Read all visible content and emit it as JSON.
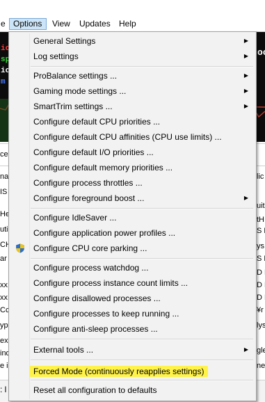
{
  "menubar": {
    "items": [
      {
        "label": "e"
      },
      {
        "label": "Options"
      },
      {
        "label": "View"
      },
      {
        "label": "Updates"
      },
      {
        "label": "Help"
      }
    ]
  },
  "background": {
    "graph_fragments": [
      "ic",
      "sp",
      "ic",
      "m"
    ],
    "graph_right_fragment": "oc",
    "mid_fragment": "ce",
    "list_left": [
      "na",
      "IS",
      "He",
      "uti",
      "CH",
      "ar",
      "xx",
      "xx",
      "Cc",
      "yp",
      "exe",
      "ind",
      "e i"
    ],
    "list_right": [
      "lic",
      "uit",
      "tH",
      "S R",
      "ys",
      "S M",
      "D E",
      "D E",
      "D E",
      "¥r",
      "lys",
      "gle",
      "ne"
    ],
    "bottom_fragment": ": l"
  },
  "menu": {
    "items": [
      {
        "label": "General Settings",
        "submenu": true
      },
      {
        "label": "Log settings",
        "submenu": true
      },
      {
        "label": "ProBalance settings ...",
        "submenu": true
      },
      {
        "label": "Gaming mode settings ...",
        "submenu": true
      },
      {
        "label": "SmartTrim settings ...",
        "submenu": true
      },
      {
        "label": "Configure default CPU priorities ...",
        "submenu": false
      },
      {
        "label": "Configure default CPU affinities (CPU use limits) ...",
        "submenu": false
      },
      {
        "label": "Configure default I/O priorities ...",
        "submenu": false
      },
      {
        "label": "Configure default memory priorities ...",
        "submenu": false
      },
      {
        "label": "Configure process throttles ...",
        "submenu": false
      },
      {
        "label": "Configure foreground boost ...",
        "submenu": true
      },
      {
        "label": "Configure IdleSaver ...",
        "submenu": false
      },
      {
        "label": "Configure application power profiles ...",
        "submenu": false
      },
      {
        "label": "Configure CPU core parking ...",
        "submenu": false,
        "icon": "uac-shield-icon"
      },
      {
        "label": "Configure process watchdog ...",
        "submenu": false
      },
      {
        "label": "Configure process instance count limits ...",
        "submenu": false
      },
      {
        "label": "Configure disallowed processes ...",
        "submenu": false
      },
      {
        "label": "Configure processes to keep running ...",
        "submenu": false
      },
      {
        "label": "Configure anti-sleep processes ...",
        "submenu": false
      },
      {
        "label": "External tools ...",
        "submenu": true
      },
      {
        "label": "Forced Mode (continuously reapplies settings)",
        "submenu": false,
        "highlighted": true
      },
      {
        "label": "Reset all configuration to defaults",
        "submenu": false
      }
    ]
  },
  "colors": {
    "highlight": "#fff34a",
    "active_menu_bg": "#cce4f7",
    "graph_bg": "#0c0c0c"
  }
}
